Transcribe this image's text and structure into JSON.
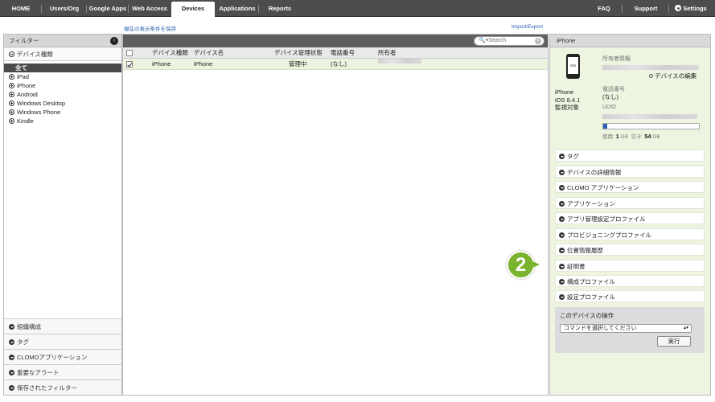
{
  "nav": {
    "tabs": [
      "HOME",
      "Users/Org",
      "Google Apps",
      "Web Access",
      "Devices",
      "Applications",
      "Reports"
    ],
    "active": "Devices",
    "faq": "FAQ",
    "support": "Support",
    "settings": "Settings"
  },
  "links": {
    "save_view": "現在の表示条件を保存",
    "import_export": "Import/Export"
  },
  "filter": {
    "title": "フィルター",
    "device_type_header": "デバイス種類",
    "device_types": [
      "全て",
      "iPad",
      "iPhone",
      "Android",
      "Windows Desktop",
      "Windows Phone",
      "Kindle"
    ],
    "selected": "全て",
    "bottom_sections": [
      "組織構成",
      "タグ",
      "CLOMOアプリケーション",
      "重要なアラート",
      "保存されたフィルター"
    ]
  },
  "device_list": {
    "search_placeholder": "Search",
    "columns": [
      "デバイス種類",
      "デバイス名",
      "デバイス管理状態",
      "電話番号",
      "所有者"
    ],
    "rows": [
      {
        "type": "iPhone",
        "name": "iPhone",
        "status": "管理中",
        "phone": "(なし)",
        "owner": ""
      }
    ]
  },
  "detail": {
    "title": "iPhone",
    "device_name": "iPhone",
    "os": "iOS 8.4.1",
    "supervised": "監視対象",
    "phone_icon_text": "iOS",
    "owner_label": "所有者情報",
    "edit_link": "デバイスの編集",
    "phone_label": "電話番号",
    "phone_value": "(なし)",
    "udid_label": "UDID",
    "usage_label": "使用:",
    "used_value": "1",
    "used_unit": "GB",
    "free_label": "空き:",
    "free_value": "54",
    "free_unit": "GB",
    "usage_fraction": 0.02,
    "sections": [
      "タグ",
      "デバイスの詳細情報",
      "CLOMO アプリケーション",
      "アプリケーション",
      "アプリ管理設定プロファイル",
      "プロビジョニングプロファイル",
      "位置情報履歴",
      "証明書",
      "構成プロファイル",
      "設定プロファイル"
    ],
    "ops_title": "このデバイスの操作",
    "ops_select": "コマンドを選択してください",
    "run_button": "実行"
  },
  "badge": "2",
  "colors": {
    "nav_bg": "#4d4d4d",
    "detail_bg": "#edf4df",
    "selected_row": "#ecf4df",
    "badge": "#7ab32e",
    "link": "#2a5db0"
  }
}
